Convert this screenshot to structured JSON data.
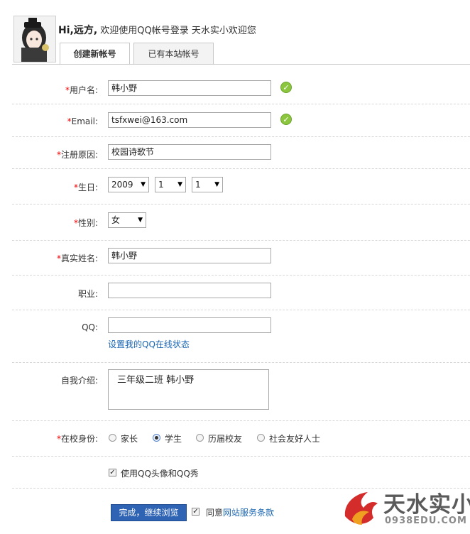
{
  "header": {
    "greeting_hi": "Hi,远方,",
    "greeting_text": "欢迎使用QQ帐号登录 天水实小欢迎您",
    "tabs": [
      "创建新帐号",
      "已有本站帐号"
    ]
  },
  "form": {
    "username": {
      "label": "用户名:",
      "value": "韩小野"
    },
    "email": {
      "label": "Email:",
      "value": "tsfxwei@163.com"
    },
    "reason": {
      "label": "注册原因:",
      "value": "校园诗歌节"
    },
    "birthday": {
      "label": "生日:",
      "year": "2009",
      "month": "1",
      "day": "1"
    },
    "gender": {
      "label": "性别:",
      "value": "女"
    },
    "realname": {
      "label": "真实姓名:",
      "value": "韩小野"
    },
    "job": {
      "label": "职业:",
      "value": ""
    },
    "qq": {
      "label": "QQ:",
      "value": "",
      "link": "设置我的QQ在线状态"
    },
    "intro": {
      "label": "自我介绍:",
      "value": "三年级二班  韩小野"
    },
    "identity": {
      "label": "在校身份:",
      "options": [
        "家长",
        "学生",
        "历届校友",
        "社会友好人士"
      ],
      "selected": "学生"
    },
    "use_avatar": {
      "label": "使用QQ头像和QQ秀",
      "checked": true
    },
    "submit_label": "完成，继续浏览",
    "agree": {
      "prefix": "同意",
      "link": "网站服务条款",
      "checked": true
    }
  },
  "required_mark": "*",
  "watermark": {
    "title": "天水实小",
    "subtitle": "0938EDU.COM"
  },
  "colors": {
    "accent": "#2f64b4",
    "required": "#ee0000",
    "link": "#1a66b3",
    "ok": "#8cc63f"
  }
}
